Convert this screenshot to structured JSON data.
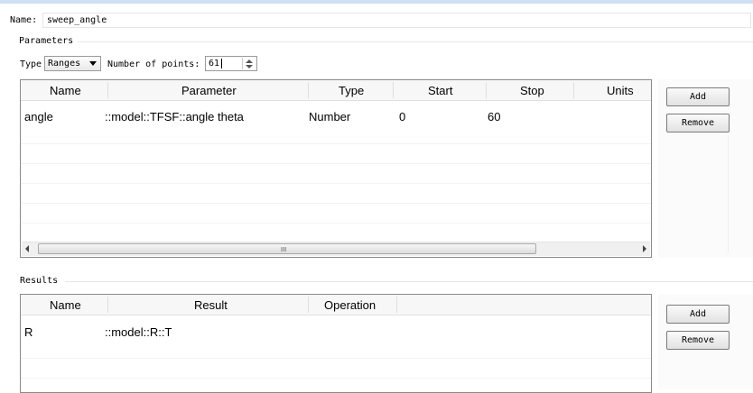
{
  "name": {
    "label": "Name:",
    "value": "sweep_angle"
  },
  "parameters": {
    "section_title": "Parameters",
    "type_label": "Type",
    "type_value": "Ranges",
    "points_label": "Number of points:",
    "points_value": "61",
    "columns": [
      "Name",
      "Parameter",
      "Type",
      "Start",
      "Stop",
      "Units"
    ],
    "rows": [
      {
        "name": "angle",
        "parameter": "::model::TFSF::angle theta",
        "type": "Number",
        "start": "0",
        "stop": "60",
        "units": ""
      }
    ],
    "scroll_grip": "III",
    "add_label": "Add",
    "remove_label": "Remove"
  },
  "results": {
    "section_title": "Results",
    "columns": [
      "Name",
      "Result",
      "Operation"
    ],
    "rows": [
      {
        "name": "R",
        "result": "::model::R::T",
        "operation": ""
      }
    ],
    "add_label": "Add",
    "remove_label": "Remove"
  },
  "colors": {
    "accent_bar": "#cfe0f4",
    "border": "#8a8a8a"
  }
}
